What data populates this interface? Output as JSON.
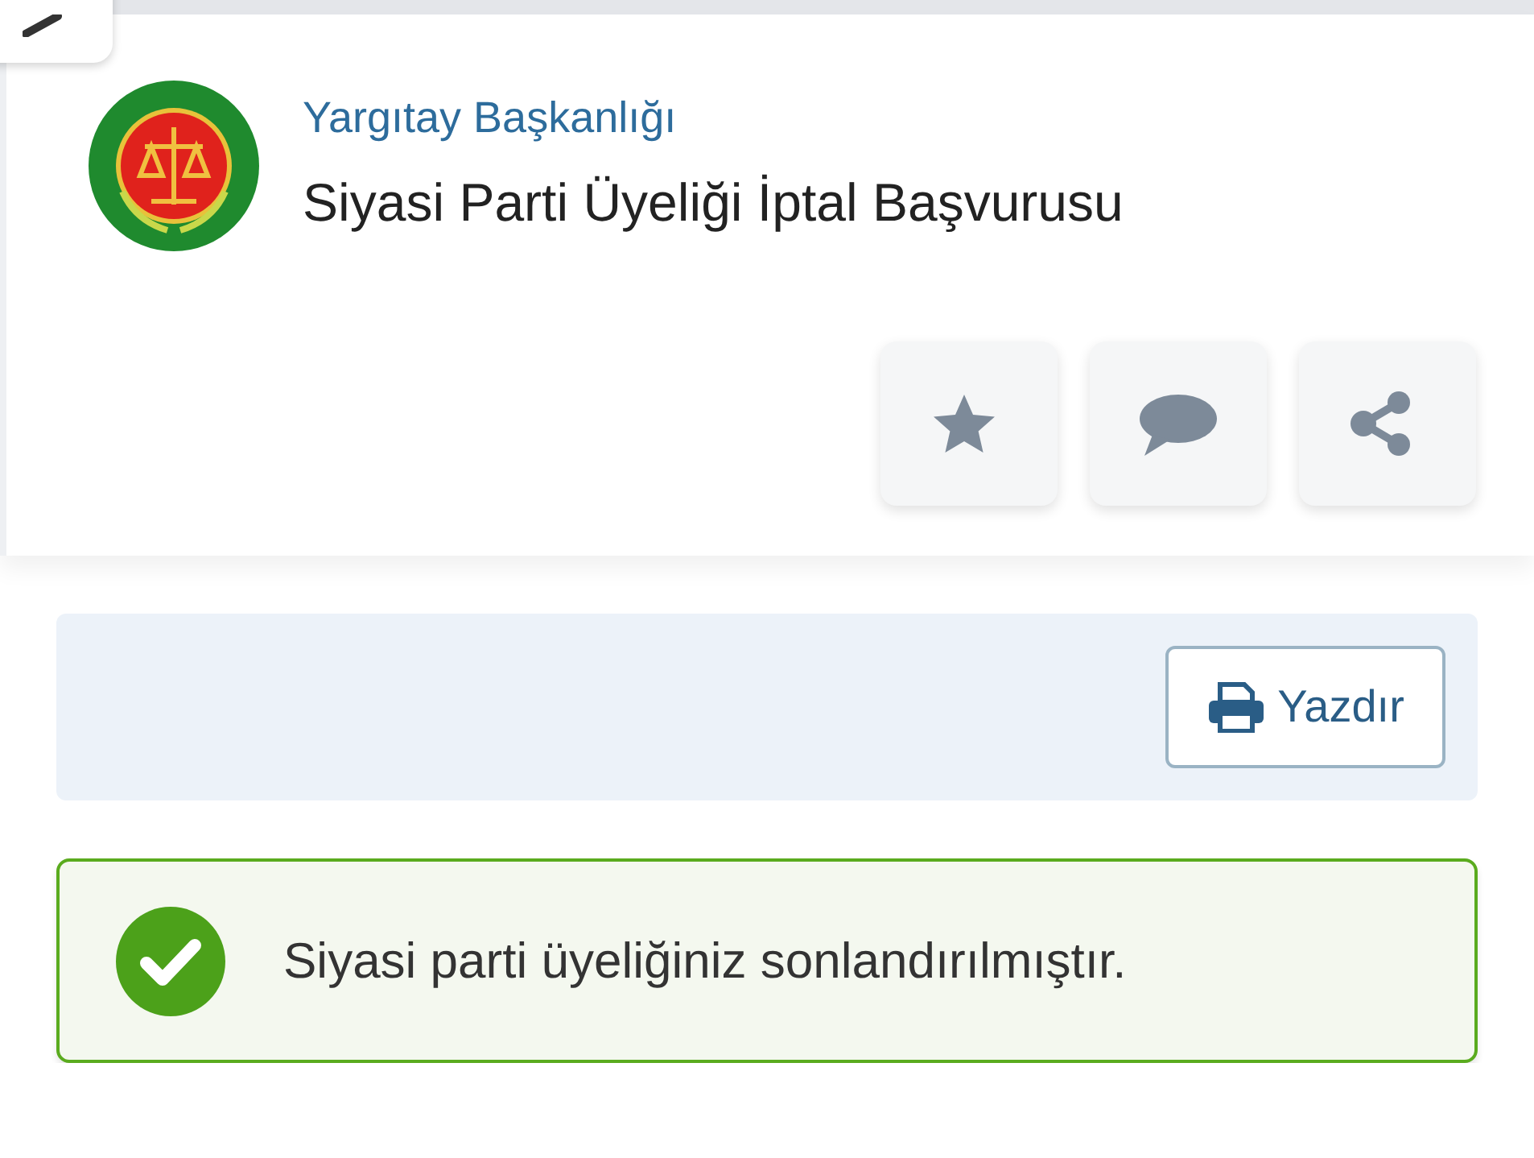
{
  "header": {
    "agency": "Yargıtay Başkanlığı",
    "title": "Siyasi Parti Üyeliği İptal Başvurusu"
  },
  "actions": [
    {
      "kind": "favorite"
    },
    {
      "kind": "comment"
    },
    {
      "kind": "share"
    }
  ],
  "toolbar": {
    "print_button": "Yazdır"
  },
  "alert": {
    "kind": "success",
    "message": "Siyasi parti üyeliğiniz sonlandırılmıştır."
  }
}
